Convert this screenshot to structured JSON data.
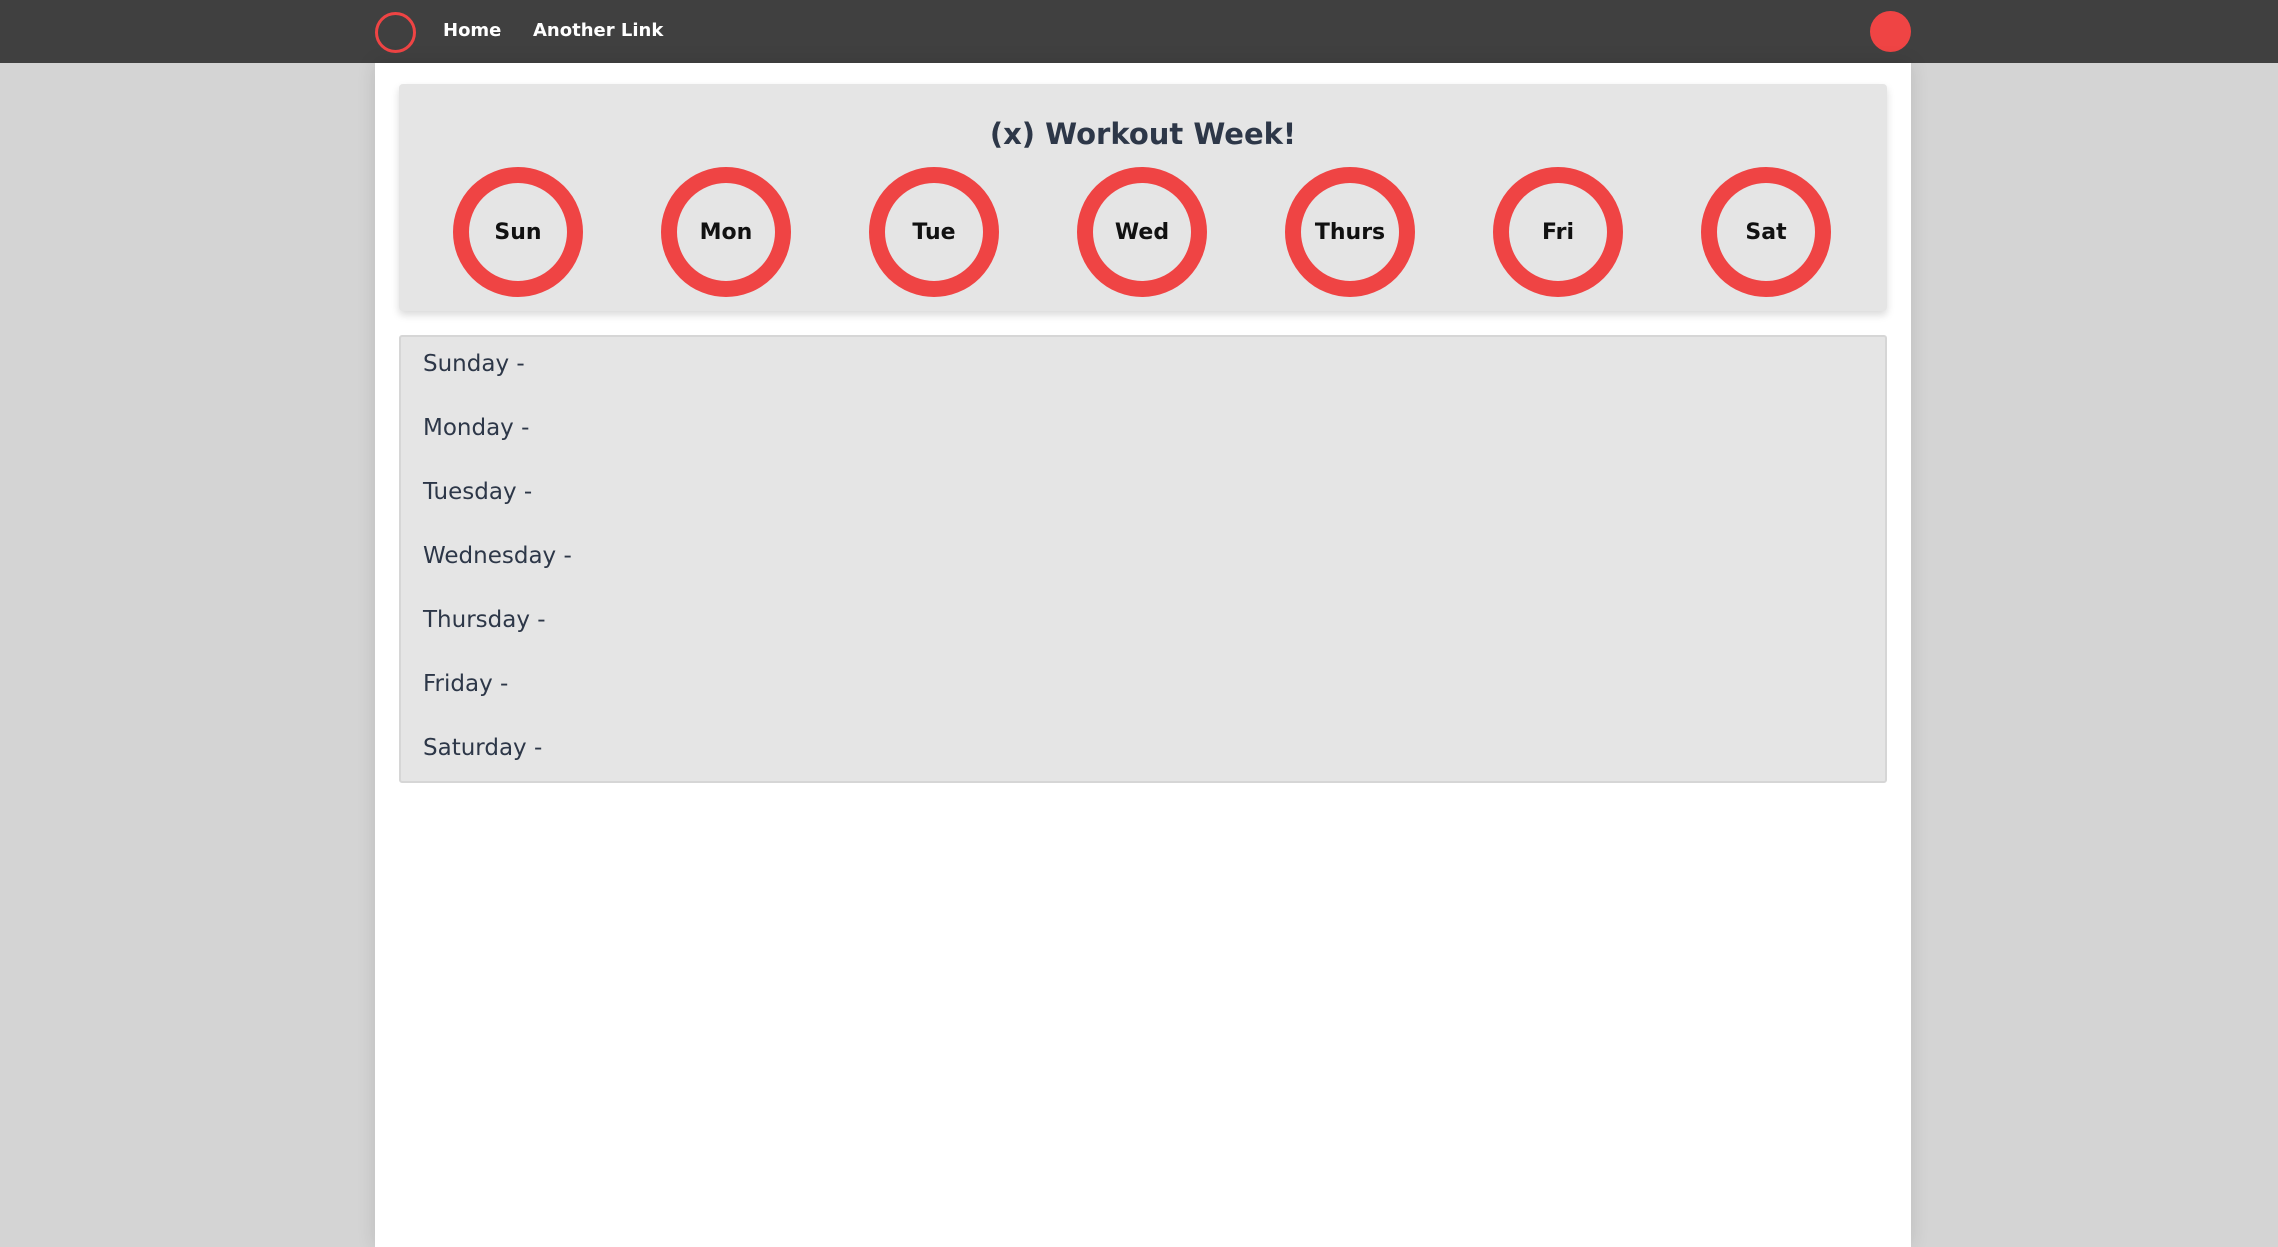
{
  "nav": {
    "logo_icon": "circle-logo-icon",
    "links": [
      {
        "label": "Home"
      },
      {
        "label": "Another Link"
      }
    ],
    "avatar_icon": "user-avatar-icon"
  },
  "week": {
    "title": "(x) Workout Week!",
    "days": [
      {
        "label": "Sun"
      },
      {
        "label": "Mon"
      },
      {
        "label": "Tue"
      },
      {
        "label": "Wed"
      },
      {
        "label": "Thurs"
      },
      {
        "label": "Fri"
      },
      {
        "label": "Sat"
      }
    ]
  },
  "schedule": {
    "rows": [
      {
        "label": "Sunday -"
      },
      {
        "label": "Monday -"
      },
      {
        "label": "Tuesday -"
      },
      {
        "label": "Wednesday -"
      },
      {
        "label": "Thursday -"
      },
      {
        "label": "Friday -"
      },
      {
        "label": "Saturday -"
      }
    ]
  },
  "colors": {
    "accent": "#ef4444",
    "navbar": "#404040",
    "card": "#e5e5e5",
    "background": "#d4d4d4",
    "text": "#2d3748"
  }
}
